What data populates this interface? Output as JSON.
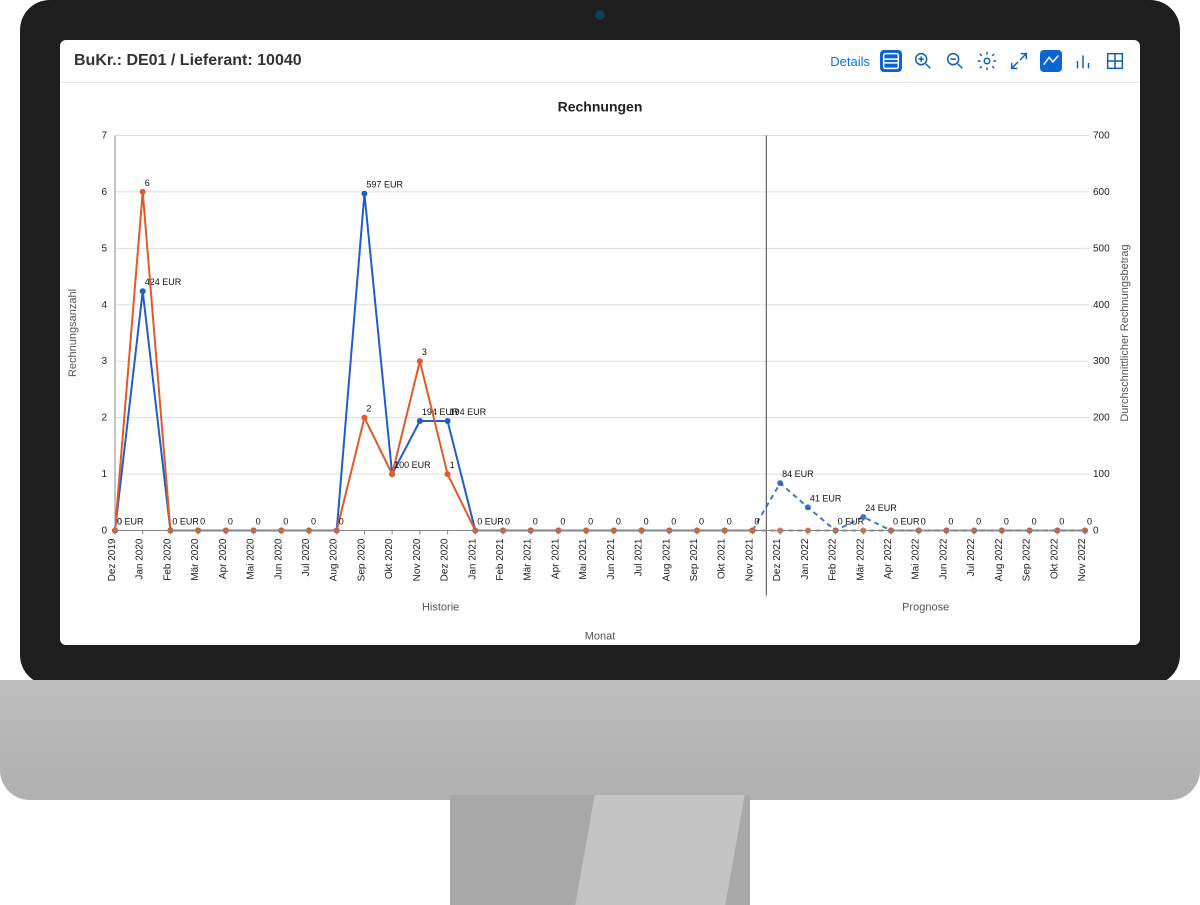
{
  "header": {
    "title": "BuKr.: DE01 / Lieferant: 10040",
    "details_label": "Details"
  },
  "colors": {
    "count": "#e15a2a",
    "value": "#1f5fc5",
    "forecast_count": "#f0a589",
    "forecast_value": "#8bb4e8"
  },
  "chart_data": {
    "type": "line",
    "title": "Rechnungen",
    "xlabel": "Monat",
    "ylabel_left": "Rechnungsanzahl",
    "ylabel_right": "Durchschnittlicher Rechnungsbetrag",
    "ylim_left": [
      0,
      7
    ],
    "ylim_right": [
      0,
      700
    ],
    "currency": "EUR",
    "sections": [
      {
        "name": "Historie",
        "from": "Dez 2019",
        "to": "Nov 2021"
      },
      {
        "name": "Prognose",
        "from": "Dez 2021",
        "to": "Nov 2022"
      }
    ],
    "categories": [
      "Dez 2019",
      "Jan 2020",
      "Feb 2020",
      "Mär 2020",
      "Apr 2020",
      "Mai 2020",
      "Jun 2020",
      "Jul 2020",
      "Aug 2020",
      "Sep 2020",
      "Okt 2020",
      "Nov 2020",
      "Dez 2020",
      "Jan 2021",
      "Feb 2021",
      "Mär 2021",
      "Apr 2021",
      "Mai 2021",
      "Jun 2021",
      "Jul 2021",
      "Aug 2021",
      "Sep 2021",
      "Okt 2021",
      "Nov 2021",
      "Dez 2021",
      "Jan 2022",
      "Feb 2022",
      "Mär 2022",
      "Apr 2022",
      "Mai 2022",
      "Jun 2022",
      "Jul 2022",
      "Aug 2022",
      "Sep 2022",
      "Okt 2022",
      "Nov 2022"
    ],
    "series": [
      {
        "name": "Rechnungsanzahl",
        "axis": "left",
        "dashed_from_index": 24,
        "values": [
          0,
          6,
          0,
          0,
          0,
          0,
          0,
          0,
          0,
          2,
          1,
          3,
          1,
          0,
          0,
          0,
          0,
          0,
          0,
          0,
          0,
          0,
          0,
          0,
          0,
          0,
          0,
          0,
          0,
          0,
          0,
          0,
          0,
          0,
          0,
          0
        ]
      },
      {
        "name": "Durchschnittlicher Rechnungsbetrag",
        "axis": "right",
        "dashed_from_index": 24,
        "values": [
          0,
          424,
          0,
          0,
          0,
          0,
          0,
          0,
          0,
          597,
          100,
          194,
          194,
          0,
          0,
          0,
          0,
          0,
          0,
          0,
          0,
          0,
          0,
          0,
          84,
          41,
          0,
          24,
          0,
          0,
          0,
          0,
          0,
          0,
          0,
          0
        ]
      }
    ]
  }
}
